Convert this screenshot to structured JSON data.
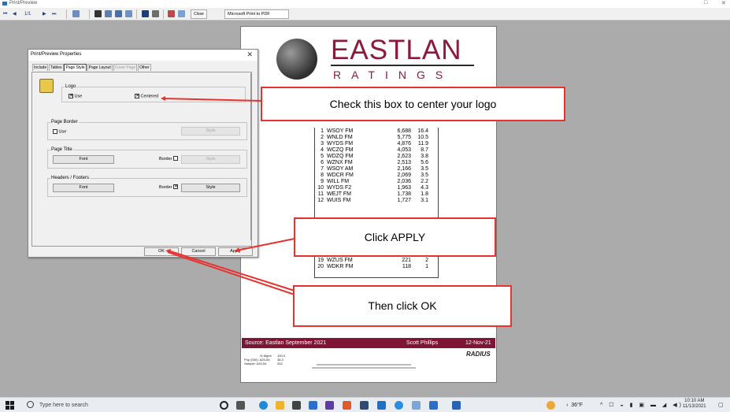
{
  "window": {
    "title": "Print/Preview",
    "controls": [
      "□",
      "✕"
    ]
  },
  "toolbar": {
    "first_glyph": "⏮",
    "prev_glyph": "◀",
    "page_indicator": "1/1",
    "next_glyph": "▶",
    "last_glyph": "⏭",
    "close_label": "Close",
    "printer_label": "Microsoft Print to PDF"
  },
  "dialog": {
    "title": "Print/Preview Properties",
    "close_glyph": "✕",
    "tabs": [
      "Include",
      "Tables",
      "Page Style",
      "Page Layout",
      "Cover Page",
      "Other"
    ],
    "active_tab": "Page Style",
    "logo_group": {
      "legend": "Logo",
      "use_label": "Use",
      "use_checked": true,
      "centered_label": "Centered",
      "centered_checked": true
    },
    "border_group": {
      "legend": "Page Border",
      "use_label": "Use",
      "use_checked": false,
      "style_label": "Style"
    },
    "title_group": {
      "legend": "Page Title",
      "font_label": "Font",
      "border_label": "Border",
      "border_checked": false,
      "style_label": "Style"
    },
    "headers_group": {
      "legend": "Headers / Footers",
      "font_label": "Font",
      "border_label": "Border",
      "border_checked": true,
      "style_label": "Style"
    },
    "ok_label": "OK",
    "cancel_label": "Cancel",
    "apply_label": "Apply"
  },
  "report": {
    "logo_main": "EASTLAN",
    "logo_sub": "RATINGS",
    "rows": [
      {
        "rank": "1",
        "station": "WSOY FM",
        "v1": "6,688",
        "v2": "16.4"
      },
      {
        "rank": "2",
        "station": "WNLD FM",
        "v1": "5,775",
        "v2": "10.5"
      },
      {
        "rank": "3",
        "station": "WYDS FM",
        "v1": "4,876",
        "v2": "11.9"
      },
      {
        "rank": "4",
        "station": "WCZQ FM",
        "v1": "4,053",
        "v2": "8.7"
      },
      {
        "rank": "5",
        "station": "WDZQ FM",
        "v1": "2,623",
        "v2": "3.8"
      },
      {
        "rank": "6",
        "station": "WZNX FM",
        "v1": "2,513",
        "v2": "5.6"
      },
      {
        "rank": "7",
        "station": "WSOY AM",
        "v1": "2,166",
        "v2": "3.5"
      },
      {
        "rank": "8",
        "station": "WDCR FM",
        "v1": "2,069",
        "v2": "3.5"
      },
      {
        "rank": "9",
        "station": "WILL FM",
        "v1": "2,036",
        "v2": "2.2"
      },
      {
        "rank": "10",
        "station": "WYDS F2",
        "v1": "1,963",
        "v2": "4.3"
      },
      {
        "rank": "11",
        "station": "WEJT FM",
        "v1": "1,738",
        "v2": "1.8"
      },
      {
        "rank": "12",
        "station": "WUIS FM",
        "v1": "1,727",
        "v2": "3.1"
      },
      {
        "rank": "19",
        "station": "WZUS FM",
        "v1": "221",
        "v2": "2"
      },
      {
        "rank": "20",
        "station": "WDKR FM",
        "v1": "118",
        "v2": "1"
      }
    ],
    "footer_source": "Source: Eastlan September 2021",
    "footer_author": "Scott Phillips",
    "footer_date": "12-Nov-21",
    "stats_headers": [
      "% Mgmt",
      "100.0",
      "38.3",
      "252"
    ],
    "stats_row1": "Pop (000): A25-54",
    "stats_row2": "Sample: A25-54",
    "radius_label": "RADIUS"
  },
  "callouts": {
    "center_logo": "Check this box to center your logo",
    "apply": "Click APPLY",
    "ok": "Then click OK"
  },
  "colors": {
    "brand": "#8b1a3b",
    "footer": "#7e1536",
    "callout_border": "#e8322f"
  },
  "taskbar": {
    "search_placeholder": "Type here to search",
    "weather": "36°F",
    "time": "10:10 AM",
    "date": "11/13/2021"
  }
}
